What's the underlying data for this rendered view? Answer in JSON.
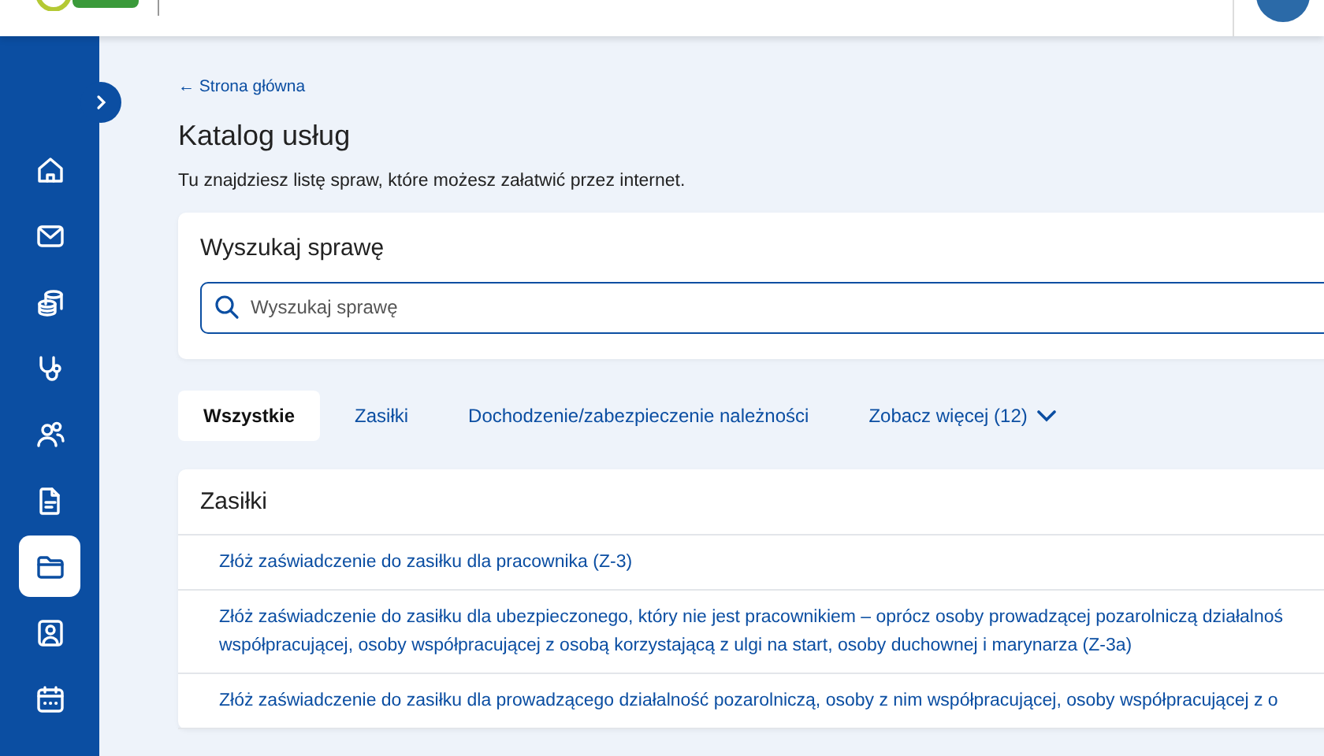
{
  "sidebar": {
    "items": [
      {
        "kind": "home",
        "selected": false
      },
      {
        "kind": "mail",
        "selected": false
      },
      {
        "kind": "coins",
        "selected": false
      },
      {
        "kind": "stethoscope",
        "selected": false
      },
      {
        "kind": "people",
        "selected": false
      },
      {
        "kind": "document",
        "selected": false
      },
      {
        "kind": "folder",
        "selected": true
      },
      {
        "kind": "contact",
        "selected": false
      },
      {
        "kind": "calendar",
        "selected": false
      }
    ]
  },
  "breadcrumb": {
    "arrow": "←",
    "label": "Strona główna"
  },
  "page": {
    "title": "Katalog usług",
    "description": "Tu znajdziesz listę spraw, które możesz załatwić przez internet."
  },
  "search": {
    "title": "Wyszukaj sprawę",
    "placeholder": "Wyszukaj sprawę"
  },
  "tabs": [
    {
      "label": "Wszystkie",
      "selected": true,
      "kind": "tab"
    },
    {
      "label": "Zasiłki",
      "selected": false,
      "kind": "tab"
    },
    {
      "label": "Dochodzenie/zabezpieczenie należności",
      "selected": false,
      "kind": "tab"
    },
    {
      "label": "Zobacz więcej (12)",
      "selected": false,
      "kind": "more"
    }
  ],
  "section": {
    "title": "Zasiłki",
    "items": [
      {
        "lines": [
          "Złóż zaświadczenie do zasiłku dla pracownika (Z-3)"
        ]
      },
      {
        "lines": [
          "Złóż zaświadczenie do zasiłku dla ubezpieczonego, który nie jest pracownikiem – oprócz osoby prowadzącej pozarolniczą działalnoś",
          "współpracującej, osoby współpracującej z osobą korzystającą z ulgi na start, osoby duchownej i marynarza (Z-3a)"
        ]
      },
      {
        "lines": [
          "Złóż zaświadczenie do zasiłku dla prowadzącego działalność pozarolniczą, osoby z nim współpracującej, osoby współpracującej z o"
        ]
      }
    ]
  }
}
